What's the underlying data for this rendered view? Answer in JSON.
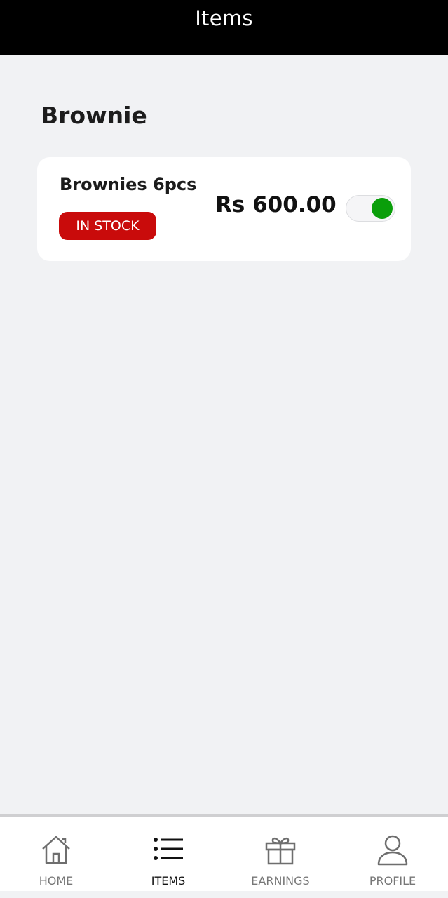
{
  "header": {
    "title": "Items"
  },
  "section": {
    "title": "Brownie"
  },
  "items": [
    {
      "name": "Brownies 6pcs",
      "badge": "IN STOCK",
      "price": "Rs 600.00",
      "enabled": true
    }
  ],
  "colors": {
    "header_bg": "#000000",
    "badge_bg": "#c90b0b",
    "toggle_on": "#0a9e0a",
    "page_bg": "#f1f2f4"
  },
  "bottom_nav": {
    "items": [
      {
        "label": "HOME",
        "icon": "home-icon",
        "active": false
      },
      {
        "label": "ITEMS",
        "icon": "list-icon",
        "active": true
      },
      {
        "label": "EARNINGS",
        "icon": "gift-icon",
        "active": false
      },
      {
        "label": "PROFILE",
        "icon": "person-icon",
        "active": false
      }
    ]
  }
}
